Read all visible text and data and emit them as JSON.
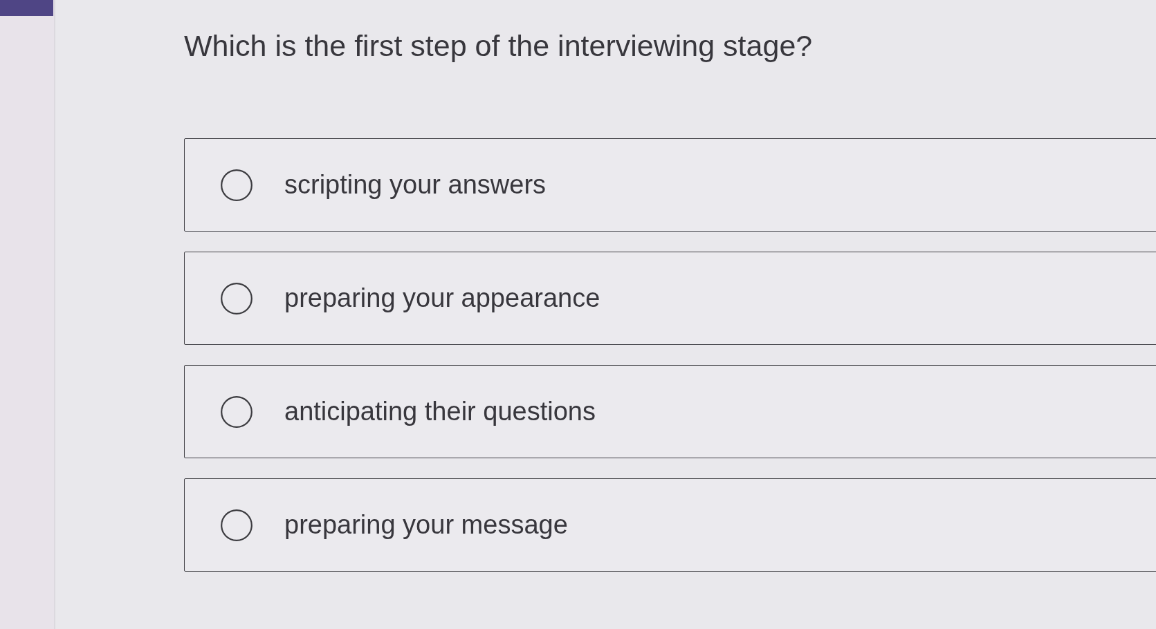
{
  "question": {
    "text": "Which is the first step of the interviewing stage?"
  },
  "options": [
    {
      "label": "scripting your answers",
      "selected": false
    },
    {
      "label": "preparing your appearance",
      "selected": false
    },
    {
      "label": "anticipating their questions",
      "selected": false
    },
    {
      "label": "preparing your message",
      "selected": false
    }
  ]
}
